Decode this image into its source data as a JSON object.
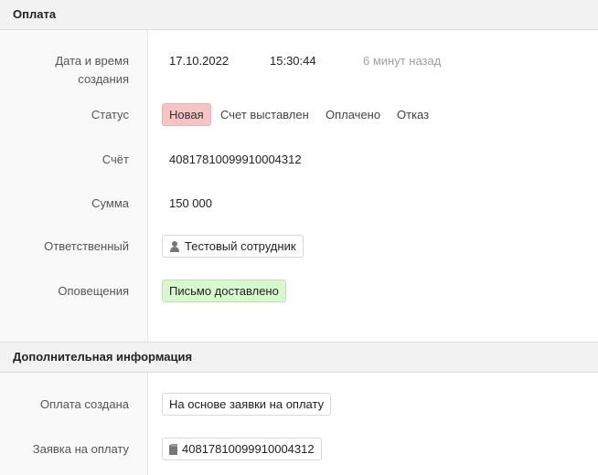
{
  "payment_section": {
    "title": "Оплата",
    "created": {
      "label_line1": "Дата и время",
      "label_line2": "создания",
      "date": "17.10.2022",
      "time": "15:30:44",
      "relative": "6 минут назад"
    },
    "status": {
      "label": "Статус",
      "options": [
        "Новая",
        "Счет выставлен",
        "Оплачено",
        "Отказ"
      ],
      "selected": "Новая",
      "active_color": "#f6c4c4"
    },
    "account": {
      "label": "Счёт",
      "value": "40817810099910004312"
    },
    "amount": {
      "label": "Сумма",
      "value": "150 000"
    },
    "responsible": {
      "label": "Ответственный",
      "value": "Тестовый сотрудник",
      "icon": "user-icon"
    },
    "notifications": {
      "label": "Оповещения",
      "value": "Письмо доставлено",
      "color": "#d9f7cf"
    }
  },
  "additional_section": {
    "title": "Дополнительная информация",
    "payment_created": {
      "label": "Оплата создана",
      "value": "На основе заявки на оплату"
    },
    "payment_request": {
      "label": "Заявка на оплату",
      "value": "40817810099910004312",
      "icon": "document-icon"
    }
  }
}
